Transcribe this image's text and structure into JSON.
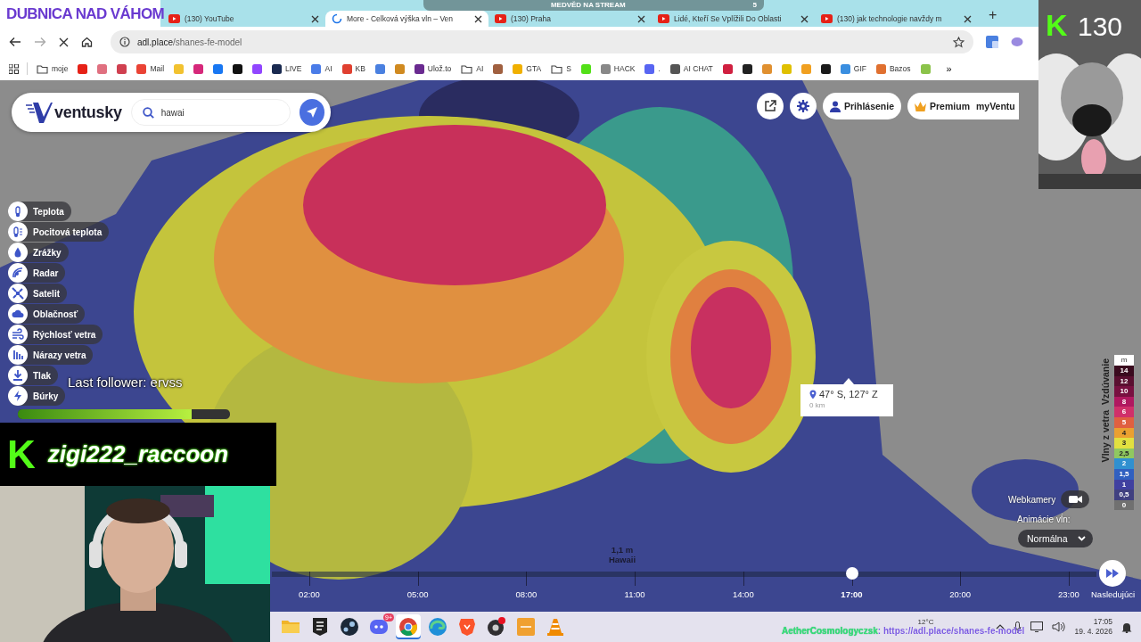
{
  "stream_overlay": {
    "city": "DUBNICA NAD VÁHOM",
    "alert": {
      "text": "MEDVĚD NA STREAM",
      "count": "5"
    },
    "cam_logo": "K",
    "cam_count": "130",
    "follower": "Last follower: ervss",
    "goal": {
      "level": 0.82
    },
    "banner_logo": "K",
    "username": "zigi222_raccoon",
    "ticker_user": "AetherCosmologyczsk",
    "ticker_text": ": https://adl.place/shanes-fe-model"
  },
  "browser": {
    "tabs": [
      {
        "title": "(130) YouTube",
        "selected": false,
        "loading": false
      },
      {
        "title": "More - Celková výška vln – Ven",
        "selected": true,
        "loading": true
      },
      {
        "title": "(130) Praha",
        "selected": false,
        "loading": false
      },
      {
        "title": "Lidé, Kteří Se Vplížili Do Oblasti",
        "selected": false,
        "loading": false
      },
      {
        "title": "(130) jak technologie navždy m",
        "selected": false,
        "loading": false
      }
    ],
    "new_tab": "+",
    "url_host": "adl.place",
    "url_path": "/shanes-fe-model",
    "bookmarks": [
      {
        "kind": "apps"
      },
      {
        "kind": "folder",
        "label": "moje"
      },
      {
        "kind": "site",
        "color": "#e62117"
      },
      {
        "kind": "site",
        "color": "#e07080"
      },
      {
        "kind": "site",
        "color": "#d04050"
      },
      {
        "kind": "site",
        "color": "#ea4335",
        "label": "Mail"
      },
      {
        "kind": "site",
        "color": "#f2c230"
      },
      {
        "kind": "site",
        "color": "#d6287a"
      },
      {
        "kind": "site",
        "color": "#1877f2"
      },
      {
        "kind": "site",
        "color": "#111111"
      },
      {
        "kind": "site",
        "color": "#9146ff"
      },
      {
        "kind": "site",
        "color": "#1a2a50",
        "label": "LIVE"
      },
      {
        "kind": "site",
        "color": "#4a7ce8",
        "label": "AI"
      },
      {
        "kind": "site",
        "color": "#e04030",
        "label": "KB"
      },
      {
        "kind": "site",
        "color": "#4a80e0"
      },
      {
        "kind": "site",
        "color": "#d08a20"
      },
      {
        "kind": "site",
        "color": "#6a2a90",
        "label": "Ulož.to"
      },
      {
        "kind": "folder",
        "label": "AI"
      },
      {
        "kind": "site",
        "color": "#a06040"
      },
      {
        "kind": "site",
        "color": "#f0b000",
        "label": "GTA"
      },
      {
        "kind": "folder",
        "label": "S"
      },
      {
        "kind": "site",
        "color": "#53e018"
      },
      {
        "kind": "site",
        "color": "#888888",
        "label": "HACK"
      },
      {
        "kind": "site",
        "color": "#5865f2",
        "label": "."
      },
      {
        "kind": "site",
        "color": "#555555",
        "label": "AI CHAT"
      },
      {
        "kind": "site",
        "color": "#d02040"
      },
      {
        "kind": "site",
        "color": "#222222"
      },
      {
        "kind": "site",
        "color": "#e09030"
      },
      {
        "kind": "site",
        "color": "#e0c000"
      },
      {
        "kind": "site",
        "color": "#f0a020"
      },
      {
        "kind": "site",
        "color": "#1a1a1a"
      },
      {
        "kind": "site",
        "color": "#3a8ee0",
        "label": "GIF"
      },
      {
        "kind": "site",
        "color": "#e07030",
        "label": "Bazos"
      },
      {
        "kind": "site",
        "color": "#8bc34a"
      },
      {
        "kind": "more",
        "label": "»"
      }
    ]
  },
  "ventusky": {
    "logo": "ventusky",
    "search": {
      "value": "hawai"
    },
    "login": "Prihlásenie",
    "premium": "Premium",
    "my": "myVentu",
    "layers": [
      {
        "label": "Teplota"
      },
      {
        "label": "Pocitová teplota"
      },
      {
        "label": "Zrážky"
      },
      {
        "label": "Radar"
      },
      {
        "label": "Satelit"
      },
      {
        "label": "Oblačnosť"
      },
      {
        "label": "Rýchlosť vetra"
      },
      {
        "label": "Nárazy vetra"
      },
      {
        "label": "Tlak"
      },
      {
        "label": "Búrky"
      }
    ],
    "tooltip": {
      "coords": "47° S, 127° Z",
      "distance": "0 km"
    },
    "point_label": {
      "value": "1,1 m",
      "place": "Hawaii"
    },
    "legend": {
      "title": "Vzdúvanie",
      "subtitle": "Vlny z vetra",
      "unit": "m",
      "steps": [
        {
          "label": "14",
          "color": "#3a0a1e"
        },
        {
          "label": "12",
          "color": "#5a0f30"
        },
        {
          "label": "10",
          "color": "#781040"
        },
        {
          "label": "8",
          "color": "#b01860"
        },
        {
          "label": "6",
          "color": "#d0306a"
        },
        {
          "label": "5",
          "color": "#e06040"
        },
        {
          "label": "4",
          "color": "#eaa030"
        },
        {
          "label": "3",
          "color": "#e2e040"
        },
        {
          "label": "2,5",
          "color": "#90c860"
        },
        {
          "label": "2",
          "color": "#3090d0"
        },
        {
          "label": "1,5",
          "color": "#3060c0"
        },
        {
          "label": "1",
          "color": "#4040a0"
        },
        {
          "label": "0,5",
          "color": "#404080"
        },
        {
          "label": "0",
          "color": "#707070"
        }
      ]
    },
    "webcams": "Webkamery",
    "animation_label": "Animácie vĺn:",
    "animation_value": "Normálna",
    "timeline": {
      "times": [
        {
          "label": "02:00",
          "selected": false
        },
        {
          "label": "05:00",
          "selected": false
        },
        {
          "label": "08:00",
          "selected": false
        },
        {
          "label": "11:00",
          "selected": false
        },
        {
          "label": "14:00",
          "selected": false
        },
        {
          "label": "17:00",
          "selected": true
        },
        {
          "label": "20:00",
          "selected": false
        },
        {
          "label": "23:00",
          "selected": false
        }
      ],
      "next": "Nasledujúci"
    }
  },
  "taskbar": {
    "apps": [
      {
        "kind": "folder",
        "selected": false
      },
      {
        "kind": "epic",
        "selected": false
      },
      {
        "kind": "steam",
        "selected": false
      },
      {
        "kind": "discord",
        "selected": false,
        "badge": "9+"
      },
      {
        "kind": "chrome",
        "selected": true
      },
      {
        "kind": "edge",
        "selected": false
      },
      {
        "kind": "brave",
        "selected": false
      },
      {
        "kind": "obs",
        "selected": false
      },
      {
        "kind": "tile",
        "selected": false
      },
      {
        "kind": "vlc",
        "selected": false
      }
    ],
    "weather": "12°C",
    "time": "17:05",
    "date": "19. 4. 2026"
  }
}
